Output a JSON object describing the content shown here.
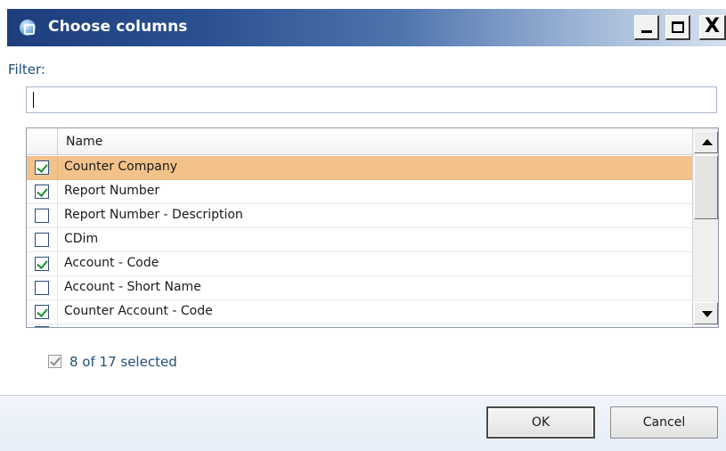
{
  "window": {
    "title": "Choose columns",
    "controls": {
      "minimize": "_",
      "maximize": "□",
      "close": "X"
    }
  },
  "filter": {
    "label": "Filter:",
    "value": "",
    "placeholder": ""
  },
  "grid": {
    "header": {
      "name": "Name"
    },
    "rows": [
      {
        "name": "Counter Company",
        "checked": true,
        "selected": true
      },
      {
        "name": "Report Number",
        "checked": true,
        "selected": false
      },
      {
        "name": "Report Number - Description",
        "checked": false,
        "selected": false
      },
      {
        "name": "CDim",
        "checked": false,
        "selected": false
      },
      {
        "name": "Account - Code",
        "checked": true,
        "selected": false
      },
      {
        "name": "Account - Short Name",
        "checked": false,
        "selected": false
      },
      {
        "name": "Counter Account - Code",
        "checked": true,
        "selected": false
      }
    ]
  },
  "summary": {
    "text": "8 of 17 selected",
    "checked": true
  },
  "footer": {
    "ok_label": "OK",
    "cancel_label": "Cancel"
  },
  "colors": {
    "title_bar_dark": "#1e3d7c",
    "selected_row": "#f3c28b",
    "link_text": "#1f4e79",
    "check_green": "#1f8f2f"
  }
}
